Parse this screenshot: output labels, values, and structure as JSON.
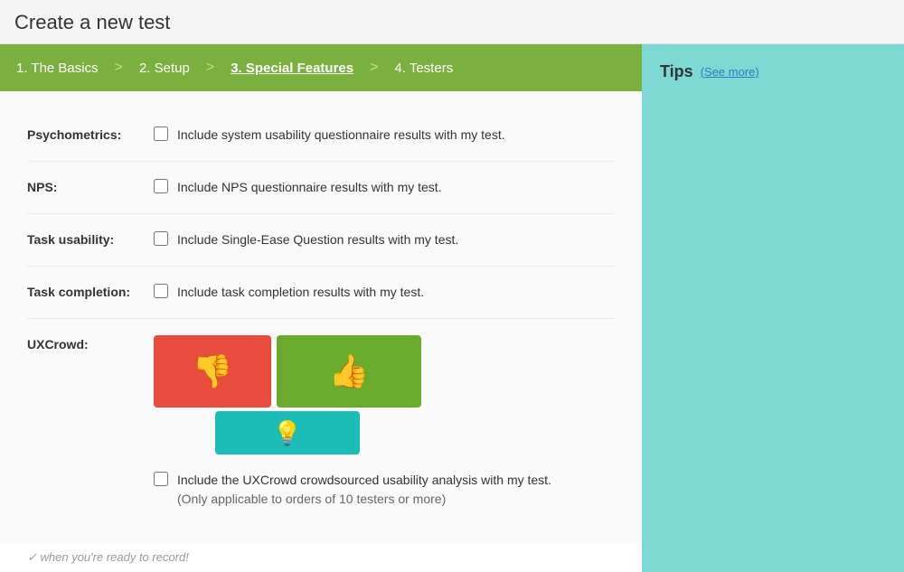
{
  "header": {
    "title": "Create a new test"
  },
  "steps": [
    {
      "id": "basics",
      "label": "1. The Basics",
      "active": false
    },
    {
      "id": "setup",
      "label": "2. Setup",
      "active": false
    },
    {
      "id": "special",
      "label": "3. Special Features",
      "active": true
    },
    {
      "id": "testers",
      "label": "4. Testers",
      "active": false
    }
  ],
  "fields": [
    {
      "id": "psychometrics",
      "label": "Psychometrics:",
      "text": "Include system usability questionnaire results with my test."
    },
    {
      "id": "nps",
      "label": "NPS:",
      "text": "Include NPS questionnaire results with my test."
    },
    {
      "id": "task-usability",
      "label": "Task usability:",
      "text": "Include Single-Ease Question results with my test."
    },
    {
      "id": "task-completion",
      "label": "Task completion:",
      "text": "Include task completion results with my test."
    }
  ],
  "uxcrowd": {
    "label": "UXCrowd:",
    "checkbox_text": "Include the UXCrowd crowdsourced usability analysis with my test.",
    "note": "(Only applicable to orders of 10 testers or more)"
  },
  "tips": {
    "title": "Tips",
    "see_more": "(See more)"
  },
  "bottom_hint": "✓ when you're ready to record!"
}
